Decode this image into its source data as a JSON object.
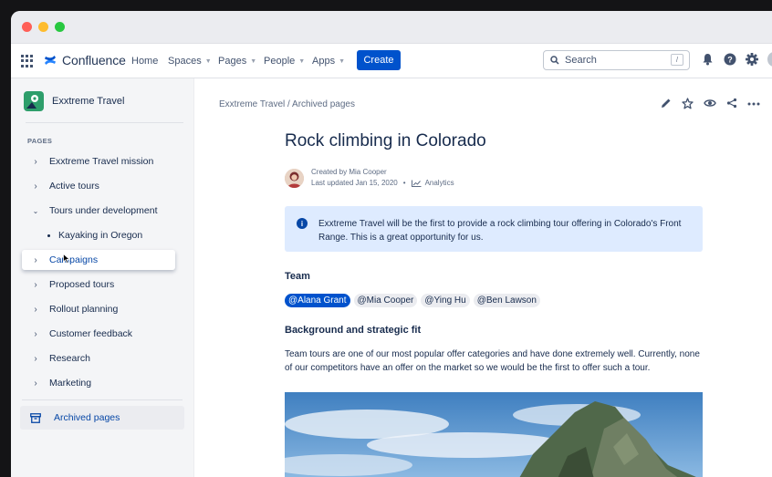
{
  "app": {
    "name": "Confluence"
  },
  "topnav": {
    "home": "Home",
    "spaces": "Spaces",
    "pages": "Pages",
    "people": "People",
    "apps": "Apps",
    "create": "Create",
    "search_placeholder": "Search",
    "search_shortcut": "/"
  },
  "sidebar": {
    "space_name": "Exxtreme Travel",
    "section_label": "PAGES",
    "items": [
      {
        "label": "Exxtreme Travel mission"
      },
      {
        "label": "Active tours"
      },
      {
        "label": "Tours under development"
      },
      {
        "label": "Kayaking in Oregon"
      },
      {
        "label": "Campaigns"
      },
      {
        "label": "Proposed tours"
      },
      {
        "label": "Rollout planning"
      },
      {
        "label": "Customer feedback"
      },
      {
        "label": "Research"
      },
      {
        "label": "Marketing"
      }
    ],
    "archived": "Archived pages"
  },
  "page": {
    "breadcrumb": "Exxtreme Travel / Archived pages",
    "title": "Rock climbing in Colorado",
    "created_by": "Created by Mia Cooper",
    "last_updated": "Last updated Jan 15, 2020",
    "analytics": "Analytics",
    "info_text": "Exxtreme Travel will be the first to provide a rock climbing tour offering in Colorado's Front Range. This is a great opportunity for us.",
    "team_heading": "Team",
    "mentions": [
      "@Alana Grant",
      "@Mia Cooper",
      "@Ying Hu",
      "@Ben Lawson"
    ],
    "background_heading": "Background and strategic fit",
    "background_text": "Team tours are one of our most popular offer categories and have done extremely well. Currently, none of our competitors have an offer on the market so we would be the first to offer such a tour."
  },
  "colors": {
    "brand": "#0052cc",
    "info_panel": "#deebff",
    "sidebar_bg": "#f4f5f7"
  }
}
